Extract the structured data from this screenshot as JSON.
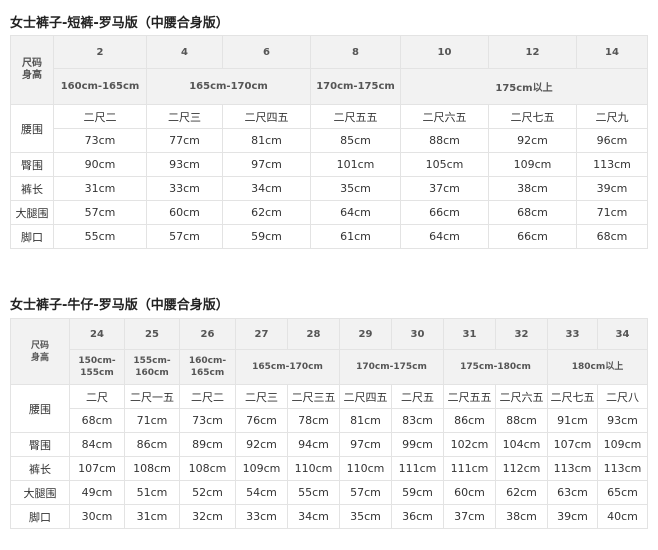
{
  "tables": [
    {
      "title": "女士裤子-短裤-罗马版（中腰合身版）",
      "size_label": "尺码",
      "height_label": "身高",
      "sizes": [
        "2",
        "4",
        "6",
        "8",
        "10",
        "12",
        "14"
      ],
      "height_ranges": [
        {
          "text": "160cm-165cm",
          "span": 1
        },
        {
          "text": "165cm-170cm",
          "span": 2
        },
        {
          "text": "170cm-175cm",
          "span": 1
        },
        {
          "text": "175cm以上",
          "span": 3
        }
      ],
      "rows": [
        {
          "label": "腰围",
          "cells": [
            "二尺二",
            "二尺三",
            "二尺四五",
            "二尺五五",
            "二尺六五",
            "二尺七五",
            "二尺九"
          ]
        },
        {
          "label": "",
          "cells": [
            "73cm",
            "77cm",
            "81cm",
            "85cm",
            "88cm",
            "92cm",
            "96cm"
          ]
        },
        {
          "label": "臀围",
          "cells": [
            "90cm",
            "93cm",
            "97cm",
            "101cm",
            "105cm",
            "109cm",
            "113cm"
          ]
        },
        {
          "label": "裤长",
          "cells": [
            "31cm",
            "33cm",
            "34cm",
            "35cm",
            "37cm",
            "38cm",
            "39cm"
          ]
        },
        {
          "label": "大腿围",
          "cells": [
            "57cm",
            "60cm",
            "62cm",
            "64cm",
            "66cm",
            "68cm",
            "71cm"
          ]
        },
        {
          "label": "脚口",
          "cells": [
            "55cm",
            "57cm",
            "59cm",
            "61cm",
            "64cm",
            "66cm",
            "68cm"
          ]
        }
      ]
    },
    {
      "title": "女士裤子-牛仔-罗马版（中腰合身版）",
      "size_label": "尺码",
      "height_label": "身高",
      "sizes": [
        "24",
        "25",
        "26",
        "27",
        "28",
        "29",
        "30",
        "31",
        "32",
        "33",
        "34"
      ],
      "height_ranges": [
        {
          "text": "150cm-155cm",
          "span": 1
        },
        {
          "text": "155cm-160cm",
          "span": 1
        },
        {
          "text": "160cm-165cm",
          "span": 1
        },
        {
          "text": "165cm-170cm",
          "span": 2
        },
        {
          "text": "170cm-175cm",
          "span": 2
        },
        {
          "text": "175cm-180cm",
          "span": 2
        },
        {
          "text": "180cm以上",
          "span": 2
        }
      ],
      "rows": [
        {
          "label": "腰围",
          "cells": [
            "二尺",
            "二尺一五",
            "二尺二",
            "二尺三",
            "二尺三五",
            "二尺四五",
            "二尺五",
            "二尺五五",
            "二尺六五",
            "二尺七五",
            "二尺八"
          ]
        },
        {
          "label": "",
          "cells": [
            "68cm",
            "71cm",
            "73cm",
            "76cm",
            "78cm",
            "81cm",
            "83cm",
            "86cm",
            "88cm",
            "91cm",
            "93cm"
          ]
        },
        {
          "label": "臀围",
          "cells": [
            "84cm",
            "86cm",
            "89cm",
            "92cm",
            "94cm",
            "97cm",
            "99cm",
            "102cm",
            "104cm",
            "107cm",
            "109cm"
          ]
        },
        {
          "label": "裤长",
          "cells": [
            "107cm",
            "108cm",
            "108cm",
            "109cm",
            "110cm",
            "110cm",
            "111cm",
            "111cm",
            "112cm",
            "113cm",
            "113cm"
          ]
        },
        {
          "label": "大腿围",
          "cells": [
            "49cm",
            "51cm",
            "52cm",
            "54cm",
            "55cm",
            "57cm",
            "59cm",
            "60cm",
            "62cm",
            "63cm",
            "65cm"
          ]
        },
        {
          "label": "脚口",
          "cells": [
            "30cm",
            "31cm",
            "32cm",
            "33cm",
            "34cm",
            "35cm",
            "36cm",
            "37cm",
            "38cm",
            "39cm",
            "40cm"
          ]
        }
      ]
    }
  ]
}
